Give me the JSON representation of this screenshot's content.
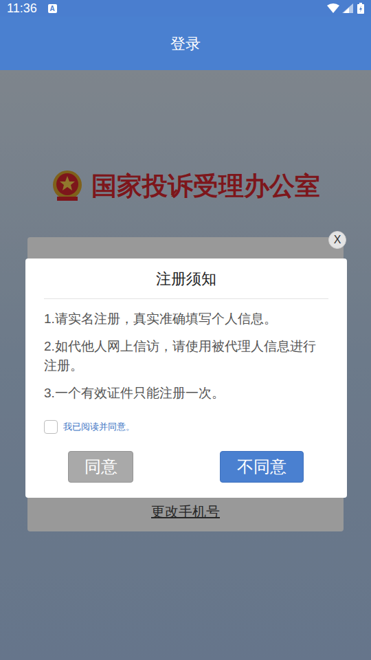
{
  "status_bar": {
    "time": "11:36",
    "notification": "A"
  },
  "app_bar": {
    "title": "登录"
  },
  "background": {
    "logo_text": "国家投诉受理办公室",
    "link": "更改手机号"
  },
  "dialog": {
    "close": "X",
    "title": "注册须知",
    "items": [
      "1.请实名注册，真实准确填写个人信息。",
      "2.如代他人网上信访，请使用被代理人信息进行注册。",
      "3.一个有效证件只能注册一次。"
    ],
    "checkbox": {
      "label": "我已阅读并同意。",
      "checked": false
    },
    "buttons": [
      {
        "label": "同意",
        "disabled": true
      },
      {
        "label": "不同意",
        "disabled": false
      }
    ]
  }
}
